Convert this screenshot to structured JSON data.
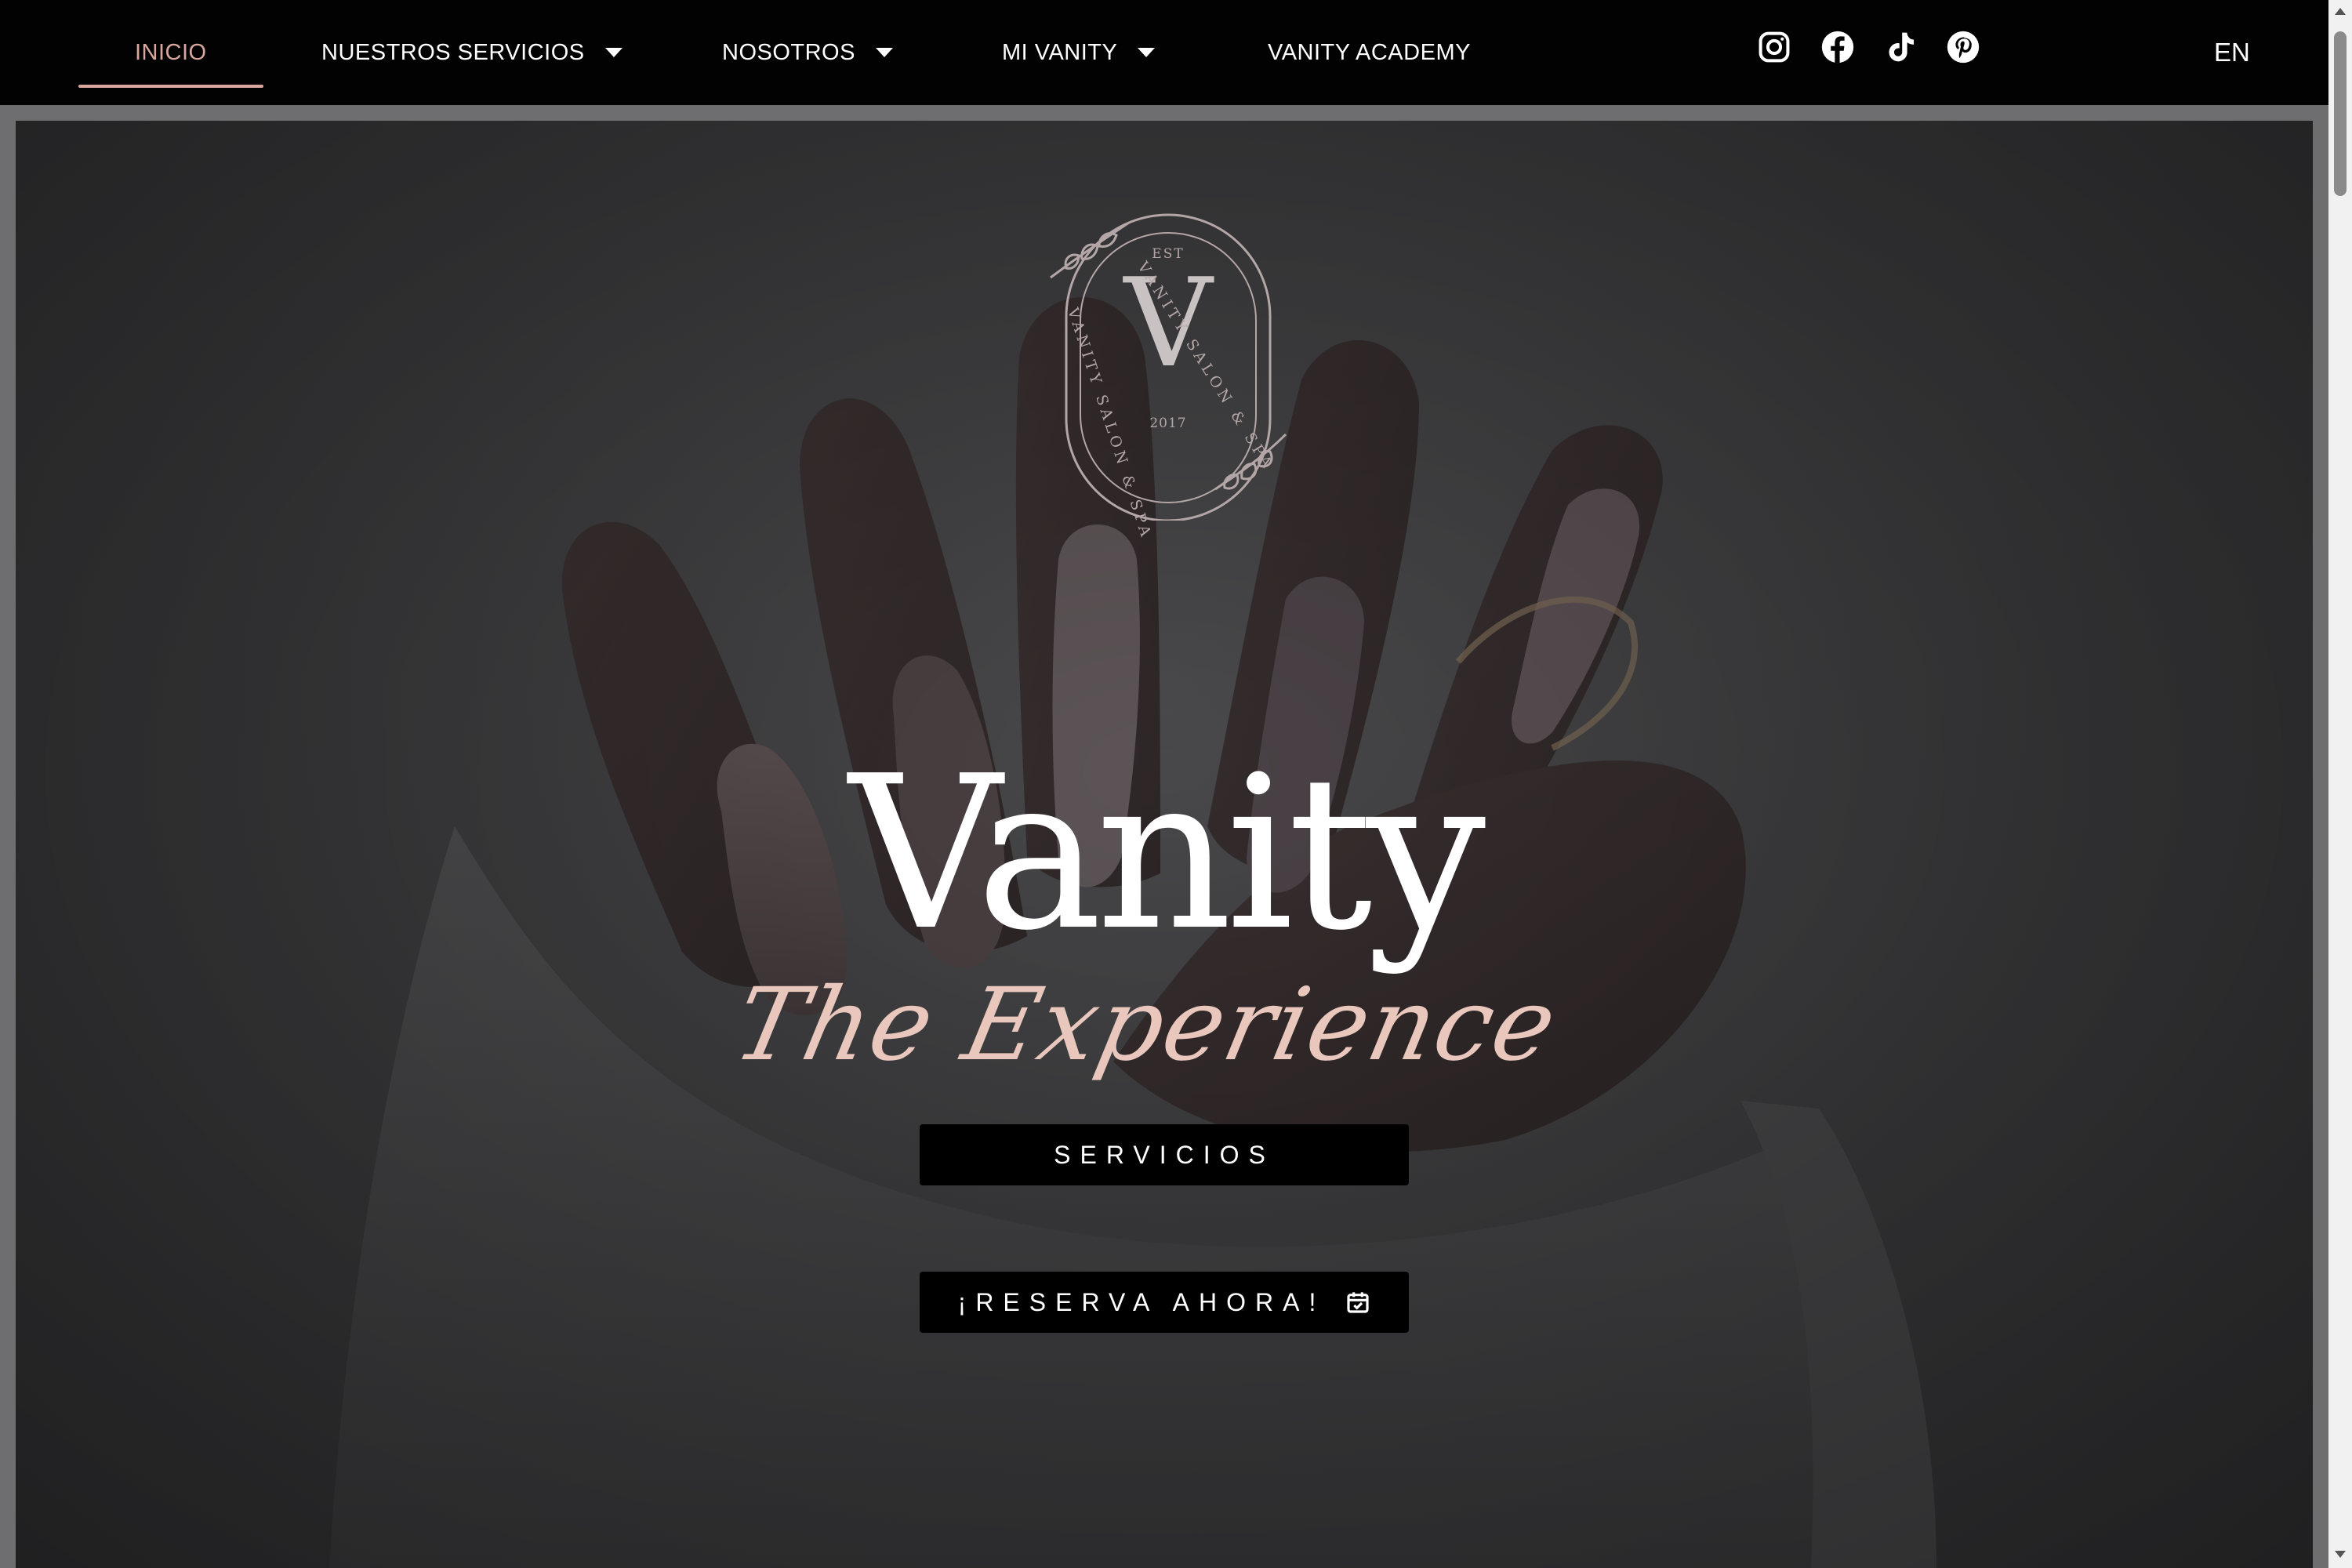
{
  "nav": {
    "items": [
      {
        "label": "INICIO",
        "active": true
      },
      {
        "label": "NUESTROS SERVICIOS",
        "dropdown": true
      },
      {
        "label": "NOSOTROS",
        "dropdown": true
      },
      {
        "label": "MI VANITY",
        "dropdown": true
      },
      {
        "label": "VANITY ACADEMY"
      }
    ],
    "social": [
      "instagram-icon",
      "facebook-icon",
      "tiktok-icon",
      "pinterest-icon"
    ],
    "language": "EN"
  },
  "hero": {
    "seal": {
      "ring_text": "VANITY SALON & SPA",
      "est": "EST",
      "letter": "V",
      "year": "2017"
    },
    "title": "Vanity",
    "tagline": "The Experience",
    "buttons": {
      "services": "SERVICIOS",
      "book": "¡RESERVA AHORA!"
    }
  },
  "colors": {
    "accent": "#d9a79e",
    "navbar": "#020202",
    "button": "#000000",
    "tagline": "#e9c7bc"
  }
}
